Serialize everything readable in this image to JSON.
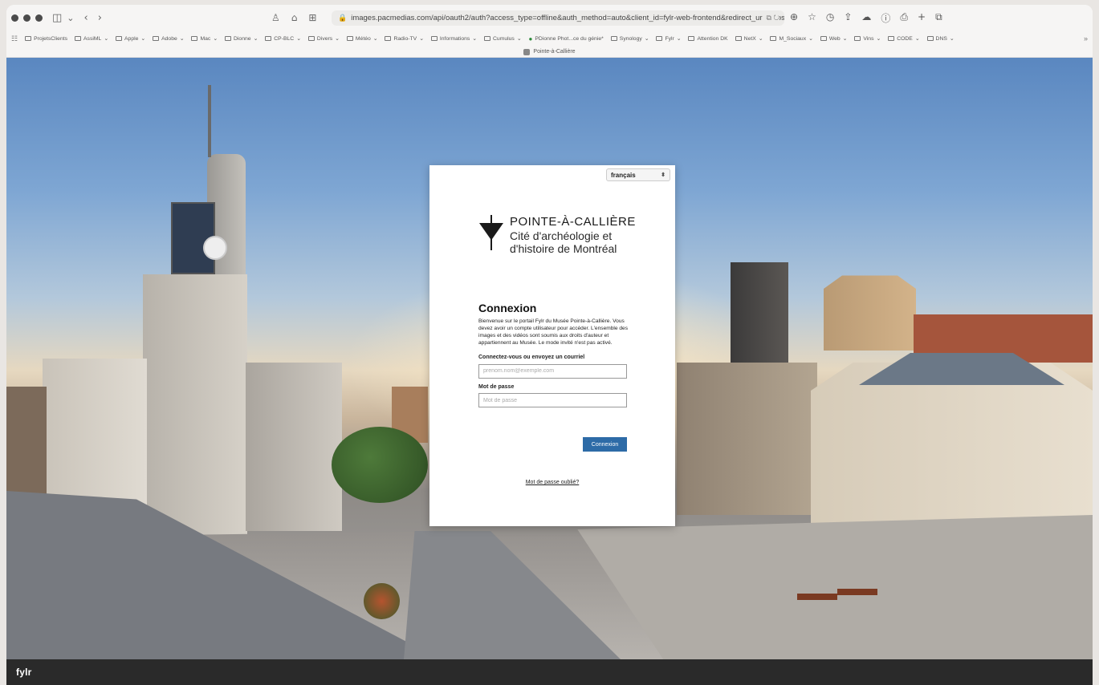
{
  "browser": {
    "url": "images.pacmedias.com/api/oauth2/auth?access_type=offline&auth_method=auto&client_id=fylr-web-frontend&redirect_uri=https",
    "tab_title": "Pointe-à-Callière",
    "bookmarks": [
      "ProjetsClients",
      "AssiML",
      "Apple",
      "Adobe",
      "Mac",
      "Dionne",
      "CP-BLC",
      "Divers",
      "Météo",
      "Radio-TV",
      "Informations",
      "Cumulus",
      "PDionne Phot...ce du génie*",
      "Synology",
      "Fylr",
      "Attention DK",
      "NetX",
      "M_Sociaux",
      "Web",
      "Vins",
      "CODE",
      "DNS"
    ]
  },
  "login": {
    "language": "français",
    "logo_name": "POINTE-À-CALLIÈRE",
    "logo_line1": "Cité d'archéologie et",
    "logo_line2": "d'histoire de Montréal",
    "title": "Connexion",
    "intro": "Bienvenue sur le portail Fylr du Musée Pointe-à-Callière. Vous devez avoir un compte utilisateur pour accéder. L'ensemble des images et des vidéos sont soumis aux droits d'auteur et appartiennent au Musée. Le mode invité n'est pas activé.",
    "email_label": "Connectez-vous ou envoyez un courriel",
    "email_placeholder": "prenom.nom@exemple.com",
    "password_label": "Mot de passe",
    "password_placeholder": "Mot de passe",
    "submit_label": "Connexion",
    "forgot_label": "Mot de passe oublié?",
    "accent_color": "#2d6ba7"
  },
  "footer": {
    "brand": "fylr"
  }
}
